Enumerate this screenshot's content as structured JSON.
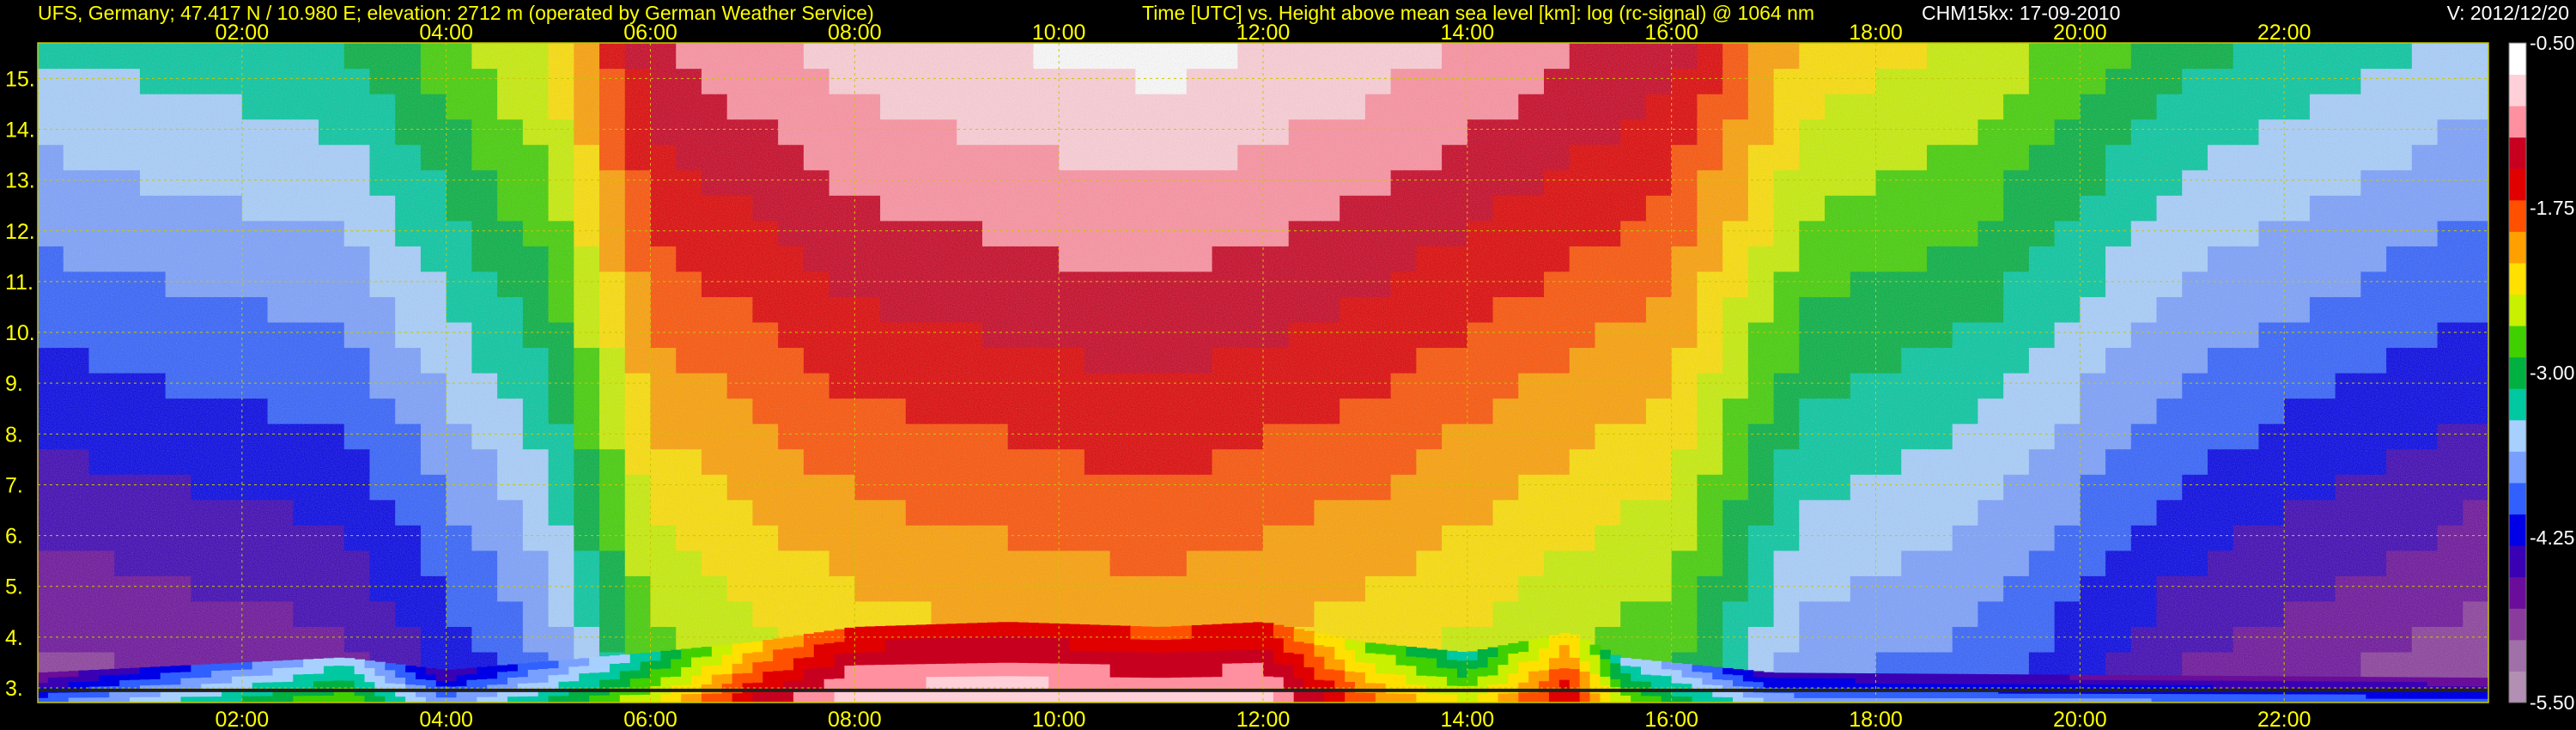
{
  "header": {
    "station": "UFS, Germany; 47.417 N / 10.980 E; elevation: 2712 m  (operated by German Weather Service)",
    "title": "Time [UTC] vs. Height above mean sea level [km]: log (rc-signal) @ 1064 nm",
    "instrument": "CHM15kx: 17-09-2010",
    "version": "V: 2012/12/20"
  },
  "colors": {
    "header_text": "#ffff00",
    "tick_text": "#ffff00",
    "grid": "#c8c800",
    "background": "#000000"
  },
  "chart_data": {
    "type": "heatmap",
    "title": "Time [UTC] vs. Height above mean sea level [km]: log (rc-signal) @ 1064 nm",
    "xlabel": "Time [UTC]",
    "ylabel": "Height above mean sea level [km]",
    "xlim": [
      0,
      24
    ],
    "ylim": [
      2.712,
      15.7
    ],
    "x_ticks": [
      "02:00",
      "04:00",
      "06:00",
      "08:00",
      "10:00",
      "12:00",
      "14:00",
      "16:00",
      "18:00",
      "20:00",
      "22:00"
    ],
    "x_tick_values": [
      2,
      4,
      6,
      8,
      10,
      12,
      14,
      16,
      18,
      20,
      22
    ],
    "y_ticks": [
      "3.",
      "4.",
      "5.",
      "6.",
      "7.",
      "8.",
      "9.",
      "10.",
      "11.",
      "12.",
      "13.",
      "14.",
      "15."
    ],
    "y_tick_values": [
      3,
      4,
      5,
      6,
      7,
      8,
      9,
      10,
      11,
      12,
      13,
      14,
      15
    ],
    "grid": true,
    "colorbar": {
      "range": [
        -5.5,
        -0.5
      ],
      "tick_labels": [
        "-0.50",
        "-1.75",
        "-3.00",
        "-4.25",
        "-5.50"
      ],
      "tick_values": [
        -0.5,
        -1.75,
        -3.0,
        -4.25,
        -5.5
      ],
      "palette": [
        "#b48fb4",
        "#a070a8",
        "#8a3c9c",
        "#6a0d9a",
        "#3a00b4",
        "#0000e6",
        "#3060ff",
        "#7aa0ff",
        "#a8d0ff",
        "#00c8a0",
        "#00b040",
        "#40d000",
        "#c8f000",
        "#ffe000",
        "#ffa000",
        "#ff5000",
        "#e00000",
        "#c80020",
        "#ff90a0",
        "#ffd0d8",
        "#ffffff"
      ]
    },
    "background_by_hour": [
      {
        "x": 0,
        "level": -3.3
      },
      {
        "x": 3,
        "level": -3.1
      },
      {
        "x": 5,
        "level": -2.3
      },
      {
        "x": 6,
        "level": -1.2
      },
      {
        "x": 8,
        "level": -0.8
      },
      {
        "x": 11,
        "level": -0.6
      },
      {
        "x": 13,
        "level": -0.8
      },
      {
        "x": 16,
        "level": -1.3
      },
      {
        "x": 17.3,
        "level": -2.2
      },
      {
        "x": 19,
        "level": -2.4
      },
      {
        "x": 21,
        "level": -3.0
      },
      {
        "x": 24,
        "level": -3.4
      }
    ],
    "boundary_layer_signal": [
      {
        "x": 0.0,
        "top": 3.3,
        "level": -4.5
      },
      {
        "x": 3.0,
        "top": 3.6,
        "level": -3.2
      },
      {
        "x": 4.0,
        "top": 3.35,
        "level": -4.3
      },
      {
        "x": 6.0,
        "top": 3.7,
        "level": -3.0
      },
      {
        "x": 7.0,
        "top": 3.9,
        "level": -2.0
      },
      {
        "x": 8.0,
        "top": 4.2,
        "level": -1.4
      },
      {
        "x": 9.5,
        "top": 4.3,
        "level": -1.3
      },
      {
        "x": 11.0,
        "top": 4.2,
        "level": -1.5
      },
      {
        "x": 12.0,
        "top": 4.3,
        "level": -1.4
      },
      {
        "x": 13.0,
        "top": 3.9,
        "level": -2.4
      },
      {
        "x": 14.0,
        "top": 3.7,
        "level": -3.0
      },
      {
        "x": 15.0,
        "top": 4.1,
        "level": -2.0
      },
      {
        "x": 15.5,
        "top": 3.6,
        "level": -3.1
      },
      {
        "x": 17.0,
        "top": 3.3,
        "level": -4.2
      },
      {
        "x": 24.0,
        "top": 3.2,
        "level": -4.5
      }
    ]
  }
}
